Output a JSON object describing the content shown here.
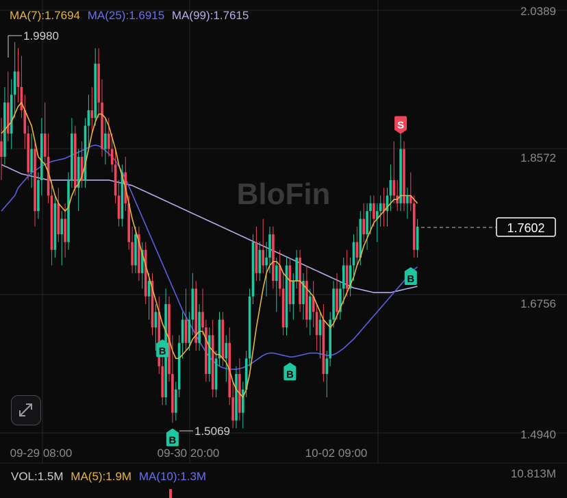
{
  "colors": {
    "background": "#0b0b0c",
    "grid": "#26262a",
    "up": "#1fc7a0",
    "down": "#f0455b",
    "ma7": "#e8b53c",
    "ma25": "#5a5fe0",
    "ma99": "#b7aee6",
    "axis_text": "#8a8a8f",
    "price_tag_border": "#ffffff",
    "watermark": "#3a3a3d"
  },
  "legend": {
    "ma7": "MA(7):1.7694",
    "ma25": "MA(25):1.6915",
    "ma99": "MA(99):1.7615"
  },
  "watermark": "BloFin",
  "volume_legend": {
    "vol": "VOL:1.5M",
    "ma5": "MA(5):1.9M",
    "ma10": "MA(10):1.3M"
  },
  "icons": {
    "expand": "expand-diagonal-icon"
  },
  "chart_data": {
    "type": "candlestick",
    "y_axis_labels": [
      "2.0389",
      "1.8572",
      "1.6756",
      "1.4940"
    ],
    "x_axis_labels": [
      "09-29 08:00",
      "09-30 20:00",
      "10-02 09:00"
    ],
    "ylim": [
      1.494,
      2.0389
    ],
    "current_price": "1.7602",
    "high_marker": "1.9980",
    "low_marker": "1.5069",
    "volume_axis_label": "10.813M",
    "grid": true,
    "markers": [
      {
        "type": "B",
        "index": 48,
        "price": 1.62
      },
      {
        "type": "B",
        "index": 51,
        "price": 1.505
      },
      {
        "type": "B",
        "index": 86,
        "price": 1.59
      },
      {
        "type": "B",
        "index": 122,
        "price": 1.713
      },
      {
        "type": "S",
        "index": 119,
        "price": 1.876
      }
    ],
    "candles": [
      [
        1.87,
        1.9,
        1.82,
        1.85
      ],
      [
        1.85,
        1.94,
        1.84,
        1.92
      ],
      [
        1.92,
        1.96,
        1.87,
        1.88
      ],
      [
        1.88,
        1.95,
        1.86,
        1.93
      ],
      [
        1.93,
        1.998,
        1.9,
        1.96
      ],
      [
        1.96,
        1.99,
        1.92,
        1.94
      ],
      [
        1.94,
        1.98,
        1.9,
        1.91
      ],
      [
        1.91,
        1.93,
        1.86,
        1.88
      ],
      [
        1.88,
        1.89,
        1.82,
        1.83
      ],
      [
        1.83,
        1.88,
        1.81,
        1.86
      ],
      [
        1.86,
        1.87,
        1.76,
        1.78
      ],
      [
        1.78,
        1.83,
        1.77,
        1.82
      ],
      [
        1.82,
        1.9,
        1.8,
        1.88
      ],
      [
        1.88,
        1.92,
        1.84,
        1.85
      ],
      [
        1.85,
        1.88,
        1.79,
        1.8
      ],
      [
        1.8,
        1.82,
        1.71,
        1.73
      ],
      [
        1.73,
        1.8,
        1.72,
        1.79
      ],
      [
        1.79,
        1.81,
        1.74,
        1.75
      ],
      [
        1.75,
        1.78,
        1.71,
        1.77
      ],
      [
        1.77,
        1.79,
        1.72,
        1.74
      ],
      [
        1.74,
        1.83,
        1.73,
        1.82
      ],
      [
        1.82,
        1.9,
        1.81,
        1.88
      ],
      [
        1.88,
        1.89,
        1.8,
        1.81
      ],
      [
        1.81,
        1.86,
        1.78,
        1.85
      ],
      [
        1.85,
        1.87,
        1.81,
        1.82
      ],
      [
        1.82,
        1.9,
        1.81,
        1.89
      ],
      [
        1.89,
        1.93,
        1.86,
        1.91
      ],
      [
        1.91,
        1.94,
        1.88,
        1.9
      ],
      [
        1.9,
        1.99,
        1.89,
        1.97
      ],
      [
        1.97,
        1.99,
        1.9,
        1.92
      ],
      [
        1.92,
        1.95,
        1.85,
        1.86
      ],
      [
        1.86,
        1.9,
        1.84,
        1.88
      ],
      [
        1.88,
        1.9,
        1.85,
        1.86
      ],
      [
        1.86,
        1.88,
        1.83,
        1.84
      ],
      [
        1.84,
        1.86,
        1.79,
        1.8
      ],
      [
        1.8,
        1.82,
        1.76,
        1.77
      ],
      [
        1.77,
        1.84,
        1.76,
        1.83
      ],
      [
        1.83,
        1.85,
        1.78,
        1.79
      ],
      [
        1.79,
        1.8,
        1.73,
        1.74
      ],
      [
        1.74,
        1.76,
        1.7,
        1.71
      ],
      [
        1.71,
        1.76,
        1.7,
        1.75
      ],
      [
        1.75,
        1.76,
        1.69,
        1.7
      ],
      [
        1.7,
        1.74,
        1.68,
        1.73
      ],
      [
        1.73,
        1.74,
        1.66,
        1.67
      ],
      [
        1.67,
        1.7,
        1.64,
        1.69
      ],
      [
        1.69,
        1.7,
        1.62,
        1.63
      ],
      [
        1.63,
        1.66,
        1.6,
        1.65
      ],
      [
        1.65,
        1.67,
        1.57,
        1.58
      ],
      [
        1.58,
        1.6,
        1.53,
        1.54
      ],
      [
        1.54,
        1.68,
        1.53,
        1.66
      ],
      [
        1.66,
        1.67,
        1.56,
        1.57
      ],
      [
        1.57,
        1.62,
        1.507,
        1.52
      ],
      [
        1.52,
        1.56,
        1.51,
        1.55
      ],
      [
        1.55,
        1.62,
        1.54,
        1.61
      ],
      [
        1.61,
        1.65,
        1.59,
        1.64
      ],
      [
        1.64,
        1.68,
        1.6,
        1.61
      ],
      [
        1.61,
        1.65,
        1.6,
        1.64
      ],
      [
        1.64,
        1.7,
        1.62,
        1.68
      ],
      [
        1.68,
        1.69,
        1.6,
        1.61
      ],
      [
        1.61,
        1.66,
        1.6,
        1.65
      ],
      [
        1.65,
        1.68,
        1.62,
        1.63
      ],
      [
        1.63,
        1.64,
        1.56,
        1.57
      ],
      [
        1.57,
        1.63,
        1.56,
        1.62
      ],
      [
        1.62,
        1.64,
        1.54,
        1.55
      ],
      [
        1.55,
        1.6,
        1.54,
        1.59
      ],
      [
        1.59,
        1.65,
        1.58,
        1.64
      ],
      [
        1.64,
        1.65,
        1.58,
        1.59
      ],
      [
        1.59,
        1.62,
        1.56,
        1.61
      ],
      [
        1.61,
        1.63,
        1.53,
        1.54
      ],
      [
        1.54,
        1.56,
        1.5,
        1.51
      ],
      [
        1.51,
        1.58,
        1.5,
        1.57
      ],
      [
        1.57,
        1.59,
        1.51,
        1.52
      ],
      [
        1.52,
        1.56,
        1.5,
        1.55
      ],
      [
        1.55,
        1.6,
        1.54,
        1.59
      ],
      [
        1.59,
        1.68,
        1.58,
        1.67
      ],
      [
        1.67,
        1.75,
        1.66,
        1.74
      ],
      [
        1.74,
        1.76,
        1.69,
        1.7
      ],
      [
        1.7,
        1.74,
        1.69,
        1.73
      ],
      [
        1.73,
        1.77,
        1.7,
        1.71
      ],
      [
        1.71,
        1.74,
        1.67,
        1.72
      ],
      [
        1.72,
        1.76,
        1.7,
        1.75
      ],
      [
        1.75,
        1.76,
        1.68,
        1.69
      ],
      [
        1.69,
        1.72,
        1.65,
        1.71
      ],
      [
        1.71,
        1.73,
        1.67,
        1.68
      ],
      [
        1.68,
        1.7,
        1.62,
        1.63
      ],
      [
        1.63,
        1.72,
        1.62,
        1.71
      ],
      [
        1.71,
        1.72,
        1.65,
        1.66
      ],
      [
        1.66,
        1.7,
        1.64,
        1.69
      ],
      [
        1.69,
        1.73,
        1.68,
        1.72
      ],
      [
        1.72,
        1.73,
        1.65,
        1.66
      ],
      [
        1.66,
        1.7,
        1.64,
        1.69
      ],
      [
        1.69,
        1.71,
        1.63,
        1.64
      ],
      [
        1.64,
        1.68,
        1.62,
        1.67
      ],
      [
        1.67,
        1.69,
        1.63,
        1.65
      ],
      [
        1.65,
        1.66,
        1.6,
        1.62
      ],
      [
        1.62,
        1.65,
        1.59,
        1.64
      ],
      [
        1.64,
        1.66,
        1.56,
        1.57
      ],
      [
        1.57,
        1.6,
        1.54,
        1.59
      ],
      [
        1.59,
        1.65,
        1.58,
        1.64
      ],
      [
        1.64,
        1.69,
        1.63,
        1.68
      ],
      [
        1.68,
        1.7,
        1.64,
        1.65
      ],
      [
        1.65,
        1.69,
        1.64,
        1.68
      ],
      [
        1.68,
        1.72,
        1.66,
        1.71
      ],
      [
        1.71,
        1.73,
        1.67,
        1.68
      ],
      [
        1.68,
        1.72,
        1.67,
        1.71
      ],
      [
        1.71,
        1.75,
        1.69,
        1.74
      ],
      [
        1.74,
        1.76,
        1.71,
        1.72
      ],
      [
        1.72,
        1.78,
        1.71,
        1.77
      ],
      [
        1.77,
        1.79,
        1.74,
        1.75
      ],
      [
        1.75,
        1.79,
        1.73,
        1.78
      ],
      [
        1.78,
        1.8,
        1.75,
        1.79
      ],
      [
        1.79,
        1.8,
        1.76,
        1.77
      ],
      [
        1.77,
        1.79,
        1.74,
        1.78
      ],
      [
        1.78,
        1.8,
        1.76,
        1.79
      ],
      [
        1.79,
        1.81,
        1.76,
        1.78
      ],
      [
        1.78,
        1.81,
        1.76,
        1.8
      ],
      [
        1.8,
        1.84,
        1.78,
        1.82
      ],
      [
        1.82,
        1.87,
        1.79,
        1.8
      ],
      [
        1.8,
        1.82,
        1.78,
        1.79
      ],
      [
        1.79,
        1.88,
        1.78,
        1.86
      ],
      [
        1.86,
        1.87,
        1.78,
        1.79
      ],
      [
        1.79,
        1.81,
        1.77,
        1.8
      ],
      [
        1.8,
        1.83,
        1.78,
        1.79
      ],
      [
        1.79,
        1.8,
        1.72,
        1.73
      ],
      [
        1.73,
        1.77,
        1.72,
        1.76
      ]
    ],
    "ma7": [
      1.88,
      1.885,
      1.89,
      1.895,
      1.905,
      1.915,
      1.92,
      1.91,
      1.9,
      1.89,
      1.87,
      1.85,
      1.845,
      1.84,
      1.83,
      1.815,
      1.8,
      1.79,
      1.785,
      1.78,
      1.785,
      1.8,
      1.81,
      1.815,
      1.825,
      1.84,
      1.86,
      1.88,
      1.895,
      1.905,
      1.905,
      1.9,
      1.89,
      1.875,
      1.86,
      1.84,
      1.825,
      1.81,
      1.79,
      1.77,
      1.755,
      1.74,
      1.725,
      1.71,
      1.695,
      1.68,
      1.665,
      1.65,
      1.635,
      1.625,
      1.615,
      1.6,
      1.59,
      1.59,
      1.595,
      1.6,
      1.605,
      1.615,
      1.62,
      1.625,
      1.625,
      1.615,
      1.605,
      1.6,
      1.595,
      1.595,
      1.59,
      1.585,
      1.575,
      1.56,
      1.55,
      1.545,
      1.54,
      1.55,
      1.57,
      1.6,
      1.63,
      1.655,
      1.68,
      1.7,
      1.71,
      1.715,
      1.715,
      1.71,
      1.7,
      1.695,
      1.69,
      1.69,
      1.69,
      1.69,
      1.685,
      1.68,
      1.675,
      1.67,
      1.66,
      1.65,
      1.64,
      1.635,
      1.63,
      1.635,
      1.645,
      1.655,
      1.665,
      1.675,
      1.685,
      1.695,
      1.71,
      1.72,
      1.735,
      1.745,
      1.755,
      1.765,
      1.77,
      1.775,
      1.78,
      1.785,
      1.79,
      1.795,
      1.795,
      1.8,
      1.8,
      1.8,
      1.8,
      1.795,
      1.79
    ],
    "ma25": [
      1.78,
      1.785,
      1.79,
      1.795,
      1.8,
      1.81,
      1.815,
      1.82,
      1.825,
      1.83,
      1.832,
      1.835,
      1.838,
      1.84,
      1.842,
      1.844,
      1.845,
      1.846,
      1.847,
      1.848,
      1.85,
      1.852,
      1.854,
      1.856,
      1.858,
      1.86,
      1.862,
      1.864,
      1.865,
      1.864,
      1.862,
      1.858,
      1.854,
      1.85,
      1.845,
      1.838,
      1.83,
      1.822,
      1.812,
      1.802,
      1.792,
      1.782,
      1.772,
      1.762,
      1.752,
      1.742,
      1.732,
      1.722,
      1.712,
      1.702,
      1.692,
      1.682,
      1.672,
      1.662,
      1.652,
      1.644,
      1.636,
      1.628,
      1.62,
      1.612,
      1.605,
      1.598,
      1.592,
      1.587,
      1.583,
      1.58,
      1.578,
      1.577,
      1.576,
      1.576,
      1.576,
      1.577,
      1.578,
      1.58,
      1.582,
      1.585,
      1.588,
      1.591,
      1.594,
      1.596,
      1.597,
      1.597,
      1.596,
      1.595,
      1.594,
      1.593,
      1.592,
      1.592,
      1.593,
      1.594,
      1.595,
      1.596,
      1.597,
      1.597,
      1.597,
      1.596,
      1.595,
      1.594,
      1.594,
      1.595,
      1.597,
      1.6,
      1.603,
      1.607,
      1.611,
      1.615,
      1.62,
      1.625,
      1.63,
      1.635,
      1.64,
      1.645,
      1.65,
      1.655,
      1.66,
      1.665,
      1.67,
      1.675,
      1.68,
      1.685,
      1.69,
      1.695,
      1.7,
      1.705,
      1.708
    ],
    "ma99": [
      1.84,
      1.838,
      1.836,
      1.834,
      1.832,
      1.83,
      1.828,
      1.827,
      1.826,
      1.825,
      1.824,
      1.823,
      1.822,
      1.821,
      1.82,
      1.82,
      1.82,
      1.82,
      1.82,
      1.82,
      1.82,
      1.82,
      1.82,
      1.82,
      1.82,
      1.82,
      1.82,
      1.82,
      1.82,
      1.82,
      1.82,
      1.82,
      1.82,
      1.819,
      1.818,
      1.817,
      1.816,
      1.815,
      1.814,
      1.813,
      1.811,
      1.809,
      1.807,
      1.805,
      1.803,
      1.801,
      1.799,
      1.797,
      1.795,
      1.793,
      1.791,
      1.789,
      1.787,
      1.785,
      1.783,
      1.781,
      1.779,
      1.777,
      1.775,
      1.773,
      1.771,
      1.769,
      1.767,
      1.765,
      1.763,
      1.761,
      1.759,
      1.757,
      1.755,
      1.753,
      1.751,
      1.749,
      1.747,
      1.745,
      1.743,
      1.741,
      1.739,
      1.737,
      1.735,
      1.733,
      1.731,
      1.729,
      1.727,
      1.725,
      1.723,
      1.721,
      1.719,
      1.717,
      1.715,
      1.713,
      1.711,
      1.709,
      1.707,
      1.705,
      1.703,
      1.701,
      1.699,
      1.697,
      1.695,
      1.693,
      1.691,
      1.689,
      1.687,
      1.685,
      1.683,
      1.681,
      1.68,
      1.679,
      1.678,
      1.677,
      1.676,
      1.675,
      1.675,
      1.675,
      1.675,
      1.675,
      1.675,
      1.676,
      1.677,
      1.678,
      1.679,
      1.68,
      1.681,
      1.682,
      1.683
    ]
  }
}
